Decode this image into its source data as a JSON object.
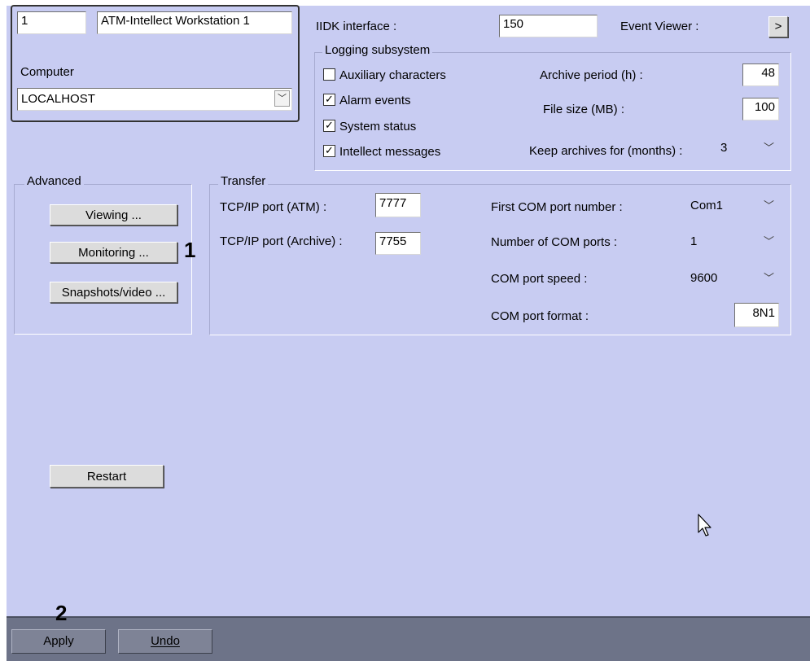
{
  "object": {
    "id": "1",
    "name": "ATM-Intellect Workstation 1",
    "computer_label": "Computer",
    "computer_value": "LOCALHOST"
  },
  "iidk": {
    "label": "IIDK interface :",
    "value": "150",
    "event_viewer_label": "Event Viewer :",
    "event_viewer_button": ">"
  },
  "logging": {
    "title": "Logging subsystem",
    "checkboxes": [
      {
        "label": "Auxiliary characters",
        "checked": false
      },
      {
        "label": "Alarm events",
        "checked": true
      },
      {
        "label": "System status",
        "checked": true
      },
      {
        "label": "Intellect messages",
        "checked": true
      }
    ],
    "archive_period_label": "Archive period (h) :",
    "archive_period_value": "48",
    "file_size_label": "File size (MB) :",
    "file_size_value": "100",
    "keep_label": "Keep archives for (months) :",
    "keep_value": "3"
  },
  "advanced": {
    "title": "Advanced",
    "buttons": [
      "Viewing ...",
      "Monitoring ...",
      "Snapshots/video ..."
    ]
  },
  "transfer": {
    "title": "Transfer",
    "tcp_atm_label": "TCP/IP port (ATM) :",
    "tcp_atm_value": "7777",
    "tcp_archive_label": "TCP/IP port (Archive) :",
    "tcp_archive_value": "7755",
    "first_com_label": "First COM port number :",
    "first_com_value": "Com1",
    "num_com_label": "Number of COM ports :",
    "num_com_value": "1",
    "com_speed_label": "COM port speed :",
    "com_speed_value": "9600",
    "com_format_label": "COM port format :",
    "com_format_value": "8N1"
  },
  "restart_button": "Restart",
  "callouts": {
    "one": "1",
    "two": "2"
  },
  "footer": {
    "apply": "Apply",
    "undo": "Undo"
  },
  "colors": {
    "panel": "#c8ccf2",
    "bottom_bar": "#6d7388"
  }
}
